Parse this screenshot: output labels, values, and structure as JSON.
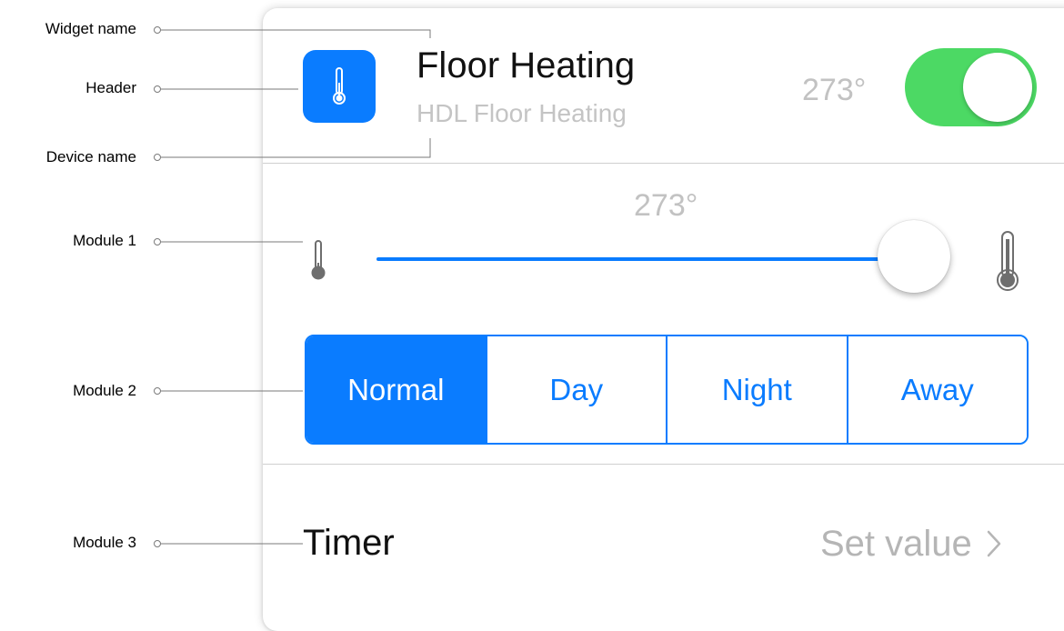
{
  "callouts": {
    "widget_name": "Widget name",
    "header": "Header",
    "device_name": "Device name",
    "module1": "Module 1",
    "module2": "Module 2",
    "module3": "Module 3"
  },
  "header": {
    "icon": "thermometer-icon",
    "title": "Floor Heating",
    "device": "HDL Floor Heating",
    "temperature": "273°",
    "power_on": true
  },
  "slider": {
    "value_label": "273°",
    "fill_fraction": 0.93,
    "min_icon": "thermometer-low-icon",
    "max_icon": "thermometer-high-icon"
  },
  "modes": {
    "options": [
      "Normal",
      "Day",
      "Night",
      "Away"
    ],
    "selected": "Normal"
  },
  "timer": {
    "label": "Timer",
    "value": "Set value",
    "icon": "chevron-right-icon"
  },
  "colors": {
    "accent": "#0a7cff",
    "toggle_on": "#4cd964",
    "secondary_text": "#c2c2c2"
  }
}
